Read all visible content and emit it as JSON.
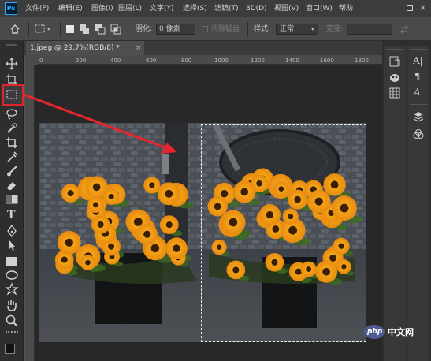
{
  "menu": {
    "logo": "Ps",
    "items": [
      "文件(F)",
      "编辑(E)",
      "图像(I)",
      "图层(L)",
      "文字(Y)",
      "选择(S)",
      "滤镜(T)",
      "3D(D)",
      "视图(V)",
      "窗口(W)",
      "帮助"
    ]
  },
  "options": {
    "feather_label": "羽化:",
    "feather_value": "0 像素",
    "antialias_label": "消除锯齿",
    "style_label": "样式:",
    "style_value": "正常",
    "width_label": "宽度:"
  },
  "document": {
    "tab_label": "1.jpeg @ 29.7%(RGB/8) *",
    "close_glyph": "×"
  },
  "ruler": {
    "top_ticks": [
      "0",
      "200",
      "400",
      "600",
      "800",
      "1000",
      "1200",
      "1400",
      "1600",
      "1800"
    ]
  },
  "selection": {
    "tool_highlight_color": "#e0242b"
  },
  "watermark": {
    "text": "中文网",
    "logo_text": "php"
  }
}
